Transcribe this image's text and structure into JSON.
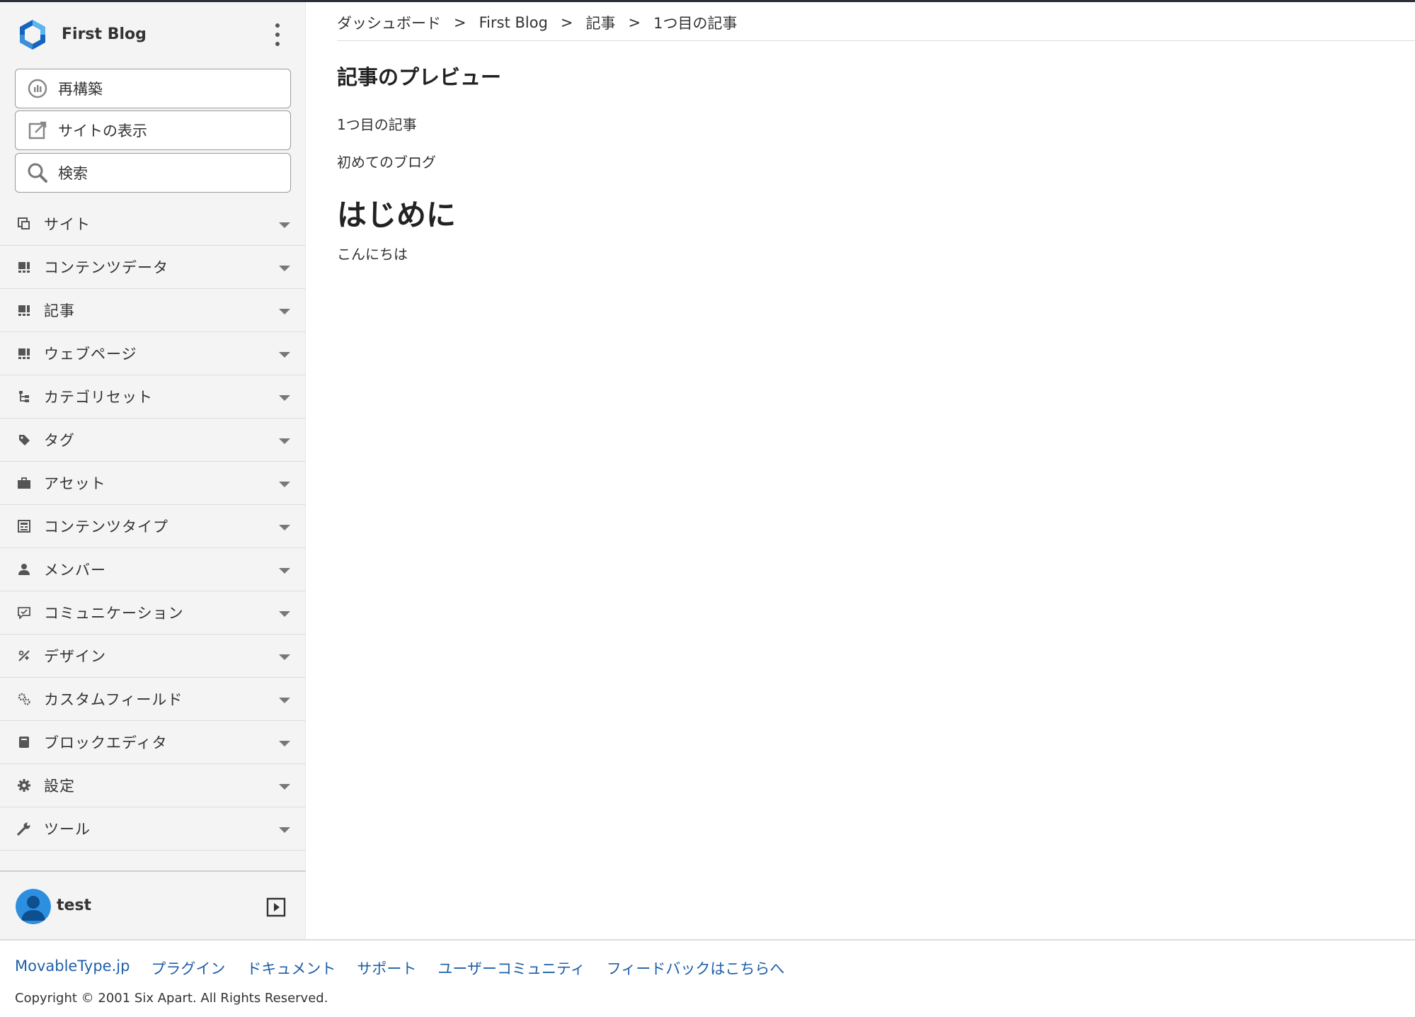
{
  "sidebar": {
    "site_name": "First Blog",
    "actions": [
      {
        "label": "再構築",
        "icon": "rebuild-icon"
      },
      {
        "label": "サイトの表示",
        "icon": "view-site-icon"
      },
      {
        "label": "検索",
        "icon": "search-icon"
      }
    ],
    "nav": [
      {
        "label": "サイト",
        "icon": "site-icon"
      },
      {
        "label": "コンテンツデータ",
        "icon": "content-data-icon"
      },
      {
        "label": "記事",
        "icon": "entry-icon"
      },
      {
        "label": "ウェブページ",
        "icon": "webpage-icon"
      },
      {
        "label": "カテゴリセット",
        "icon": "category-set-icon"
      },
      {
        "label": "タグ",
        "icon": "tag-icon"
      },
      {
        "label": "アセット",
        "icon": "asset-icon"
      },
      {
        "label": "コンテンツタイプ",
        "icon": "content-type-icon"
      },
      {
        "label": "メンバー",
        "icon": "member-icon"
      },
      {
        "label": "コミュニケーション",
        "icon": "communication-icon"
      },
      {
        "label": "デザイン",
        "icon": "design-icon"
      },
      {
        "label": "カスタムフィールド",
        "icon": "custom-field-icon"
      },
      {
        "label": "ブロックエディタ",
        "icon": "block-editor-icon"
      },
      {
        "label": "設定",
        "icon": "settings-gear-icon"
      },
      {
        "label": "ツール",
        "icon": "tools-wrench-icon"
      }
    ],
    "user": {
      "name": "test"
    }
  },
  "breadcrumb": {
    "items": [
      "ダッシュボード",
      "First Blog",
      "記事",
      "1つ目の記事"
    ],
    "separator": ">"
  },
  "main": {
    "title": "記事のプレビュー",
    "entry_title": "1つ目の記事",
    "blog_name": "初めてのブログ",
    "heading": "はじめに",
    "body": "こんにちは"
  },
  "footer": {
    "links": [
      "MovableType.jp",
      "プラグイン",
      "ドキュメント",
      "サポート",
      "ユーザーコミュニティ",
      "フィードバックはこちらへ"
    ],
    "copyright": "Copyright © 2001 Six Apart. All Rights Reserved."
  },
  "colors": {
    "link": "#1e5fa8",
    "logo_dark": "#1565c0",
    "logo_light": "#5bb5f0",
    "sidebar_bg": "#f4f4f4"
  }
}
